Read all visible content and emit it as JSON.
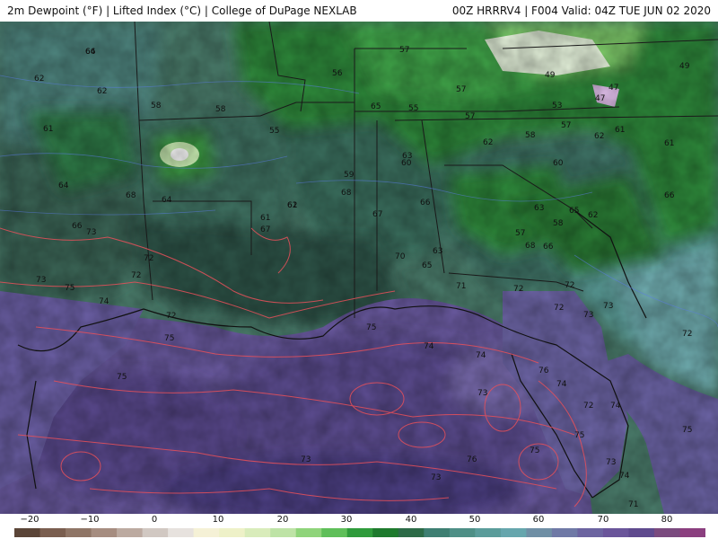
{
  "header": {
    "left": "2m Dewpoint (°F) | Lifted Index (°C) | College of DuPage NEXLAB",
    "right": "00Z HRRRV4 | F004 Valid: 04Z TUE JUN 02 2020"
  },
  "colorbar": {
    "ticks": [
      "−20",
      "−10",
      "0",
      "10",
      "20",
      "30",
      "40",
      "50",
      "60",
      "70",
      "80"
    ],
    "colors": [
      "#5b4538",
      "#7a5e4f",
      "#8f7566",
      "#a68d80",
      "#bcaaa0",
      "#d1c8c2",
      "#e7e2de",
      "#f5f1d6",
      "#eef1c8",
      "#d9ecbb",
      "#bee3a6",
      "#8fd47a",
      "#5fbf59",
      "#2f9b3b",
      "#1e7a2d",
      "#2c6b47",
      "#3e7f72",
      "#4e8f86",
      "#5a9c9a",
      "#66a6ad",
      "#6f8fa5",
      "#6f79a6",
      "#6c64a0",
      "#6a559a",
      "#5f4a8e",
      "#7a4a7e",
      "#8b3f7f"
    ]
  },
  "map": {
    "dewpoint_labels": [
      "64",
      "62",
      "62",
      "61",
      "58",
      "58",
      "56",
      "57",
      "57",
      "49",
      "49",
      "47",
      "47",
      "55",
      "55",
      "53",
      "57",
      "65",
      "61",
      "62",
      "58",
      "57",
      "62",
      "60",
      "61",
      "64",
      "68",
      "66",
      "64",
      "67",
      "61",
      "61",
      "63",
      "60",
      "62",
      "66",
      "62",
      "66",
      "59",
      "63",
      "65",
      "58",
      "57",
      "68",
      "66",
      "67",
      "68",
      "70",
      "65",
      "63",
      "71",
      "72",
      "72",
      "72",
      "73",
      "73",
      "73",
      "75",
      "73",
      "74",
      "72",
      "72",
      "72",
      "75",
      "75",
      "75",
      "74",
      "74",
      "73",
      "76",
      "74",
      "74",
      "75",
      "75",
      "72",
      "73",
      "75",
      "76",
      "73",
      "73",
      "74",
      "71",
      "72",
      "66"
    ]
  }
}
